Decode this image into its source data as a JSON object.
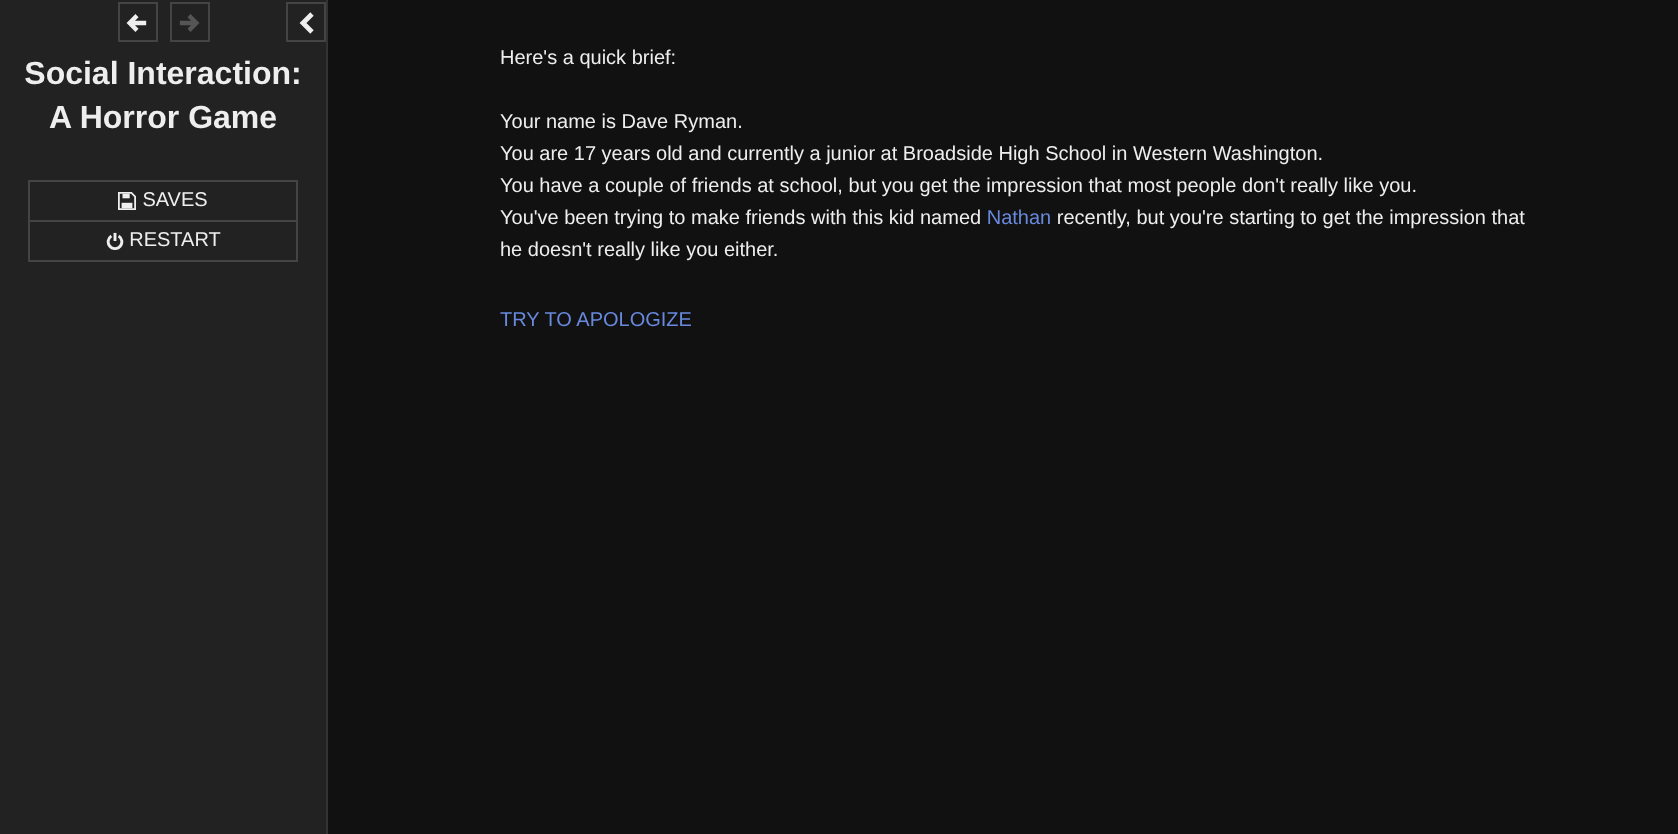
{
  "sidebar": {
    "nav": [
      {
        "kind": "back",
        "disabled": false
      },
      {
        "kind": "forward",
        "disabled": true
      }
    ],
    "title": "Social Interaction: A Horror Game",
    "menu": [
      {
        "kind": "saves",
        "label": "SAVES"
      },
      {
        "kind": "restart",
        "label": "RESTART"
      }
    ]
  },
  "passage": {
    "intro": "Here's a quick brief:",
    "lines": [
      "Your name is Dave Ryman.",
      "You are 17 years old and currently a junior at Broadside High School in Western Washington.",
      "You have a couple of friends at school, but you get the impression that most people don't really like you."
    ],
    "last_line": {
      "before": "You've been trying to make friends with this kid named",
      "link": "Nathan",
      "after": "recently, but you're starting to get the impression that he doesn't really like you either."
    },
    "choice": "TRY TO APOLOGIZE"
  }
}
